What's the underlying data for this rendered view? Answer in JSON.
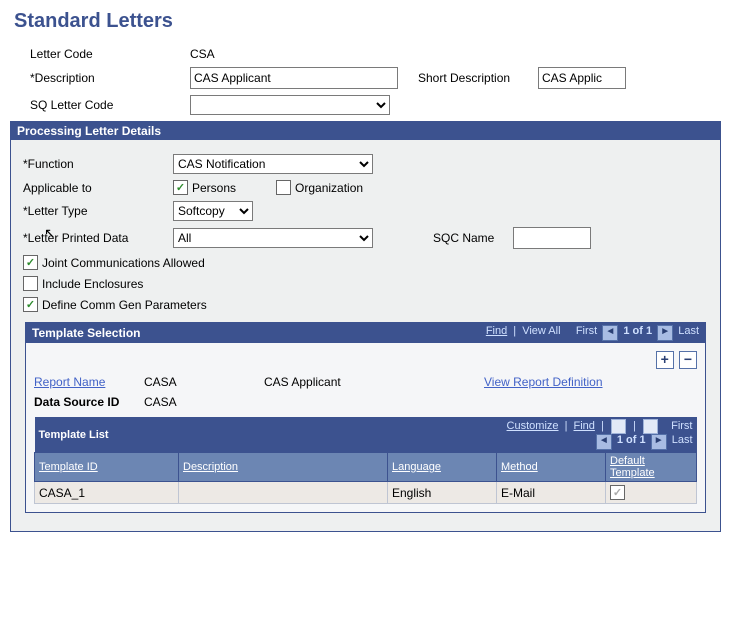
{
  "title": "Standard Letters",
  "labels": {
    "letter_code": "Letter Code",
    "description": "*Description",
    "short_description": "Short Description",
    "sqc_letter_code": "SQ  Letter Code",
    "function": "*Function",
    "applicable_to": "Applicable to",
    "persons": "Persons",
    "organization": "Organization",
    "letter_type": "*Letter Type",
    "letter_printed_data": "*Letter Printed Data",
    "sqc_name": "SQC Name",
    "joint_comm": "Joint Communications Allowed",
    "include_enclosures": "Include Enclosures",
    "define_comm": "Define Comm Gen Parameters",
    "processing_details": "Processing Letter Details",
    "template_selection": "Template Selection",
    "report_name": "Report Name",
    "data_source_id": "Data Source ID",
    "view_report_definition": "View Report Definition",
    "template_list": "Template List",
    "find": "Find",
    "view_all": "View All",
    "first": "First",
    "last": "Last",
    "customize": "Customize",
    "count": "1 of 1"
  },
  "values": {
    "letter_code": "CSA",
    "description": "CAS Applicant",
    "short_description": "CAS Applic",
    "sqc_letter_code": "",
    "function": "CAS Notification",
    "letter_type": "Softcopy",
    "letter_printed_data": "All",
    "sqc_name": "",
    "report_name": "CASA",
    "report_desc": "CAS Applicant",
    "data_source_id": "CASA"
  },
  "checks": {
    "persons": "✓",
    "organization": "",
    "joint_comm": "✓",
    "include_enclosures": "",
    "define_comm": "✓",
    "default_template": "✓"
  },
  "columns": {
    "template_id": "Template ID",
    "description": "Description",
    "language": "Language",
    "method": "Method",
    "default_template": "Default Template"
  },
  "row": {
    "template_id": "CASA_1",
    "description": "",
    "language": "English",
    "method": "E-Mail"
  }
}
